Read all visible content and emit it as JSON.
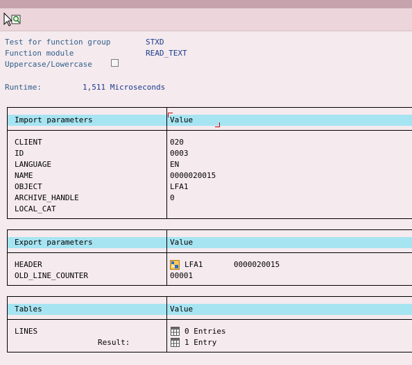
{
  "header": {
    "test_label": "Test for function group",
    "test_value": "STXD",
    "module_label": "Function module",
    "module_value": "READ_TEXT",
    "case_label": "Uppercase/Lowercase",
    "runtime_label": "Runtime:",
    "runtime_value": "1,511 Microseconds"
  },
  "import": {
    "title": "Import parameters",
    "value_header": "Value",
    "rows": [
      {
        "name": "CLIENT",
        "value": "020"
      },
      {
        "name": "ID",
        "value": "0003"
      },
      {
        "name": "LANGUAGE",
        "value": "EN"
      },
      {
        "name": "NAME",
        "value": "0000020015"
      },
      {
        "name": "OBJECT",
        "value": "LFA1"
      },
      {
        "name": "ARCHIVE_HANDLE",
        "value": "0"
      },
      {
        "name": "LOCAL_CAT",
        "value": ""
      }
    ]
  },
  "export": {
    "title": "Export parameters",
    "value_header": "Value",
    "header_row": {
      "name": "HEADER",
      "value1": "LFA1",
      "value2": "0000020015"
    },
    "counter_row": {
      "name": "OLD_LINE_COUNTER",
      "value": "00001"
    }
  },
  "tables": {
    "title": "Tables",
    "value_header": "Value",
    "lines_label": "LINES",
    "result_label": "Result:",
    "entries_before": "0 Entries",
    "entries_after": "1 Entry"
  },
  "colors": {
    "header_bar": "#a7e4f2",
    "background": "#f5eaee",
    "toolbar": "#ecd6dc",
    "label_text": "#2f5f8a"
  },
  "icons": [
    "execute-debug-icon",
    "structure-icon",
    "table-entries-icon"
  ]
}
